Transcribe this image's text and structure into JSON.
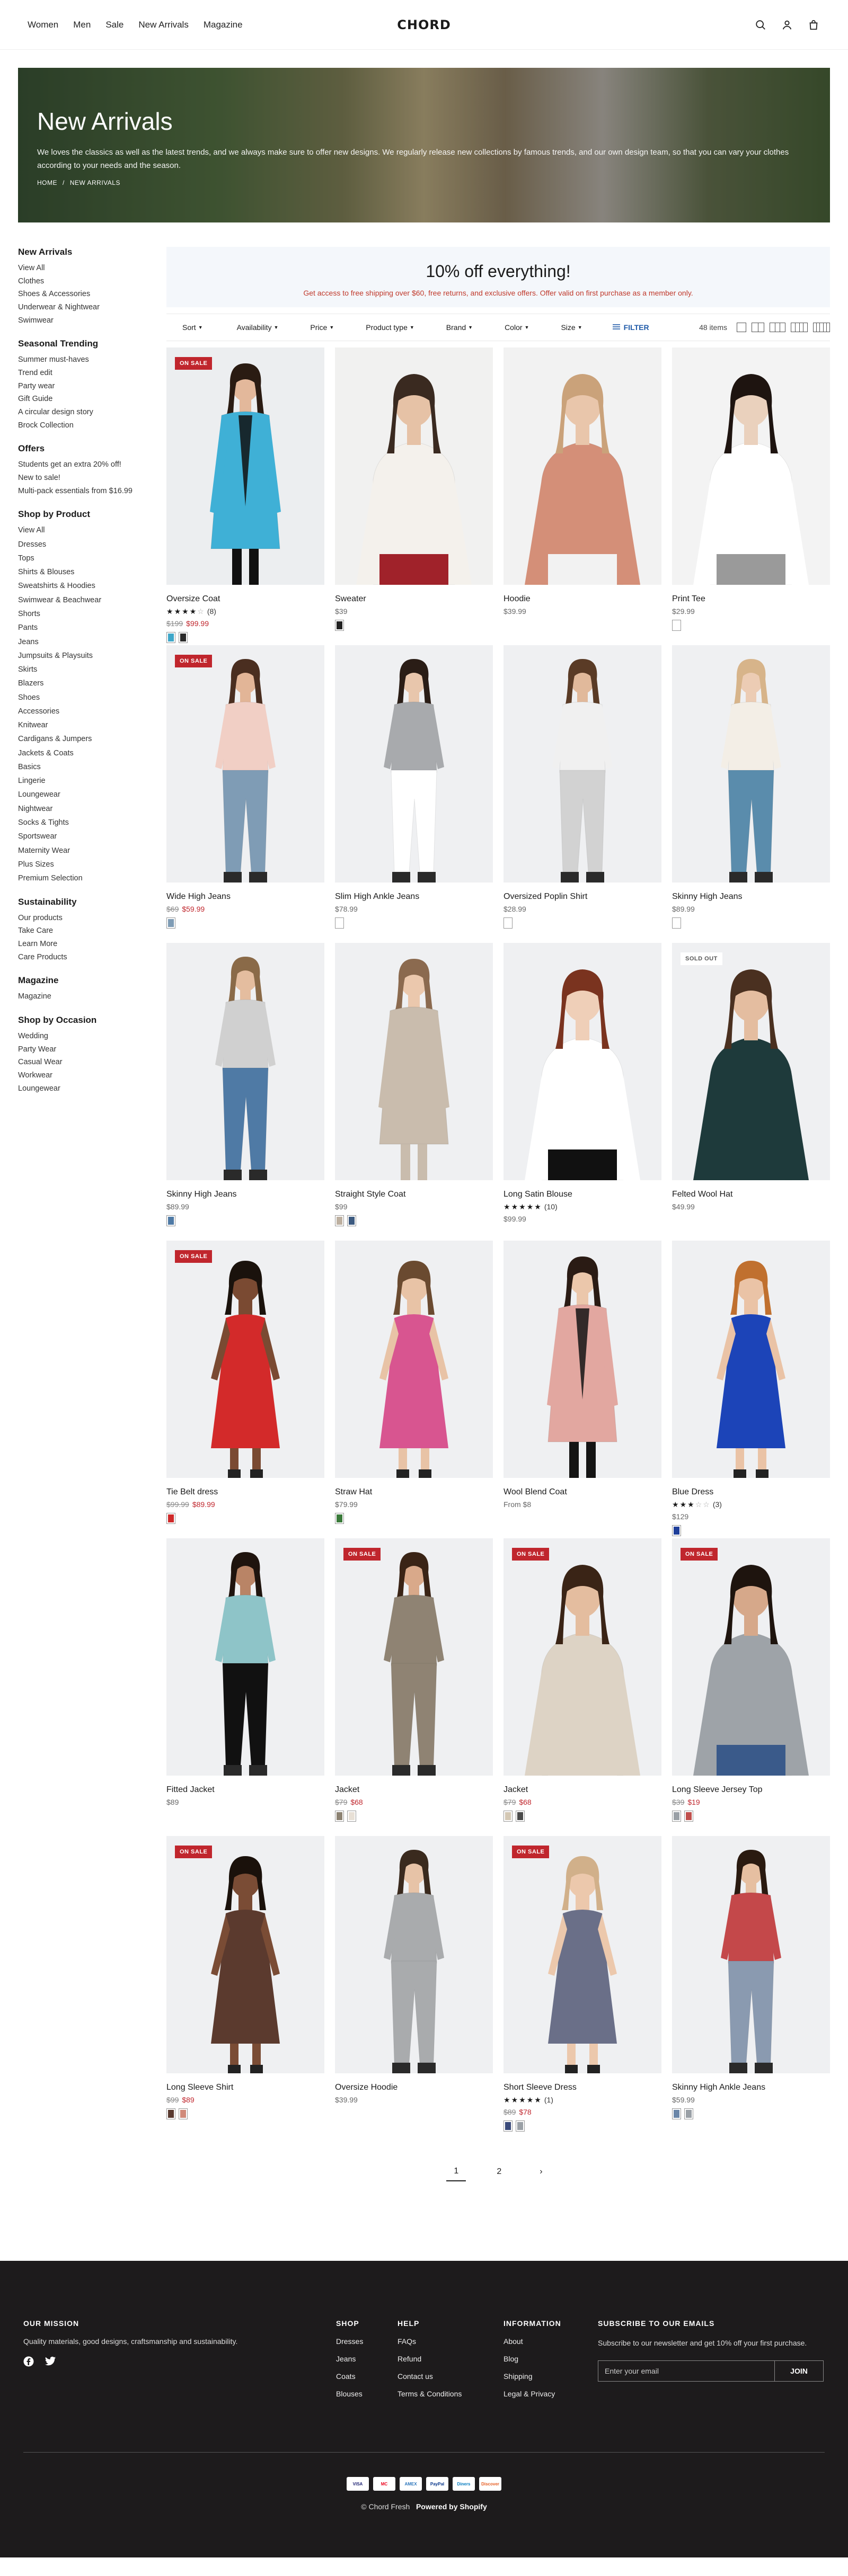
{
  "header": {
    "nav": [
      "Women",
      "Men",
      "Sale",
      "New Arrivals",
      "Magazine"
    ],
    "logo": "CHORD",
    "icons": [
      "search-icon",
      "account-icon",
      "cart-icon"
    ]
  },
  "hero": {
    "title": "New Arrivals",
    "description": "We loves the classics as well as the latest trends, and we always make sure to offer new designs. We regularly release new collections by famous trends, and our own design team, so that you can vary your clothes according to your needs and the season.",
    "breadcrumb": [
      "HOME",
      "/",
      "NEW ARRIVALS"
    ]
  },
  "sidebar": {
    "sections": [
      {
        "heading": "New Arrivals",
        "links": [
          "View All",
          "Clothes",
          "Shoes & Accessories",
          "Underwear & Nightwear",
          "Swimwear"
        ]
      },
      {
        "heading": "Seasonal Trending",
        "links": [
          "Summer must-haves",
          "Trend edit",
          "Party wear",
          "Gift Guide",
          "A circular design story",
          "Brock Collection"
        ]
      },
      {
        "heading": "Offers",
        "links": [
          "Students get an extra 20% off!",
          "New to sale!",
          "Multi-pack essentials from $16.99"
        ]
      },
      {
        "heading": "Shop by Product",
        "links": [
          "View All",
          "Dresses",
          "Tops",
          "Shirts & Blouses",
          "Sweatshirts & Hoodies",
          "Swimwear & Beachwear",
          "Shorts",
          "Pants",
          "Jeans",
          "Jumpsuits & Playsuits",
          "Skirts",
          "Blazers",
          "Shoes",
          "Accessories",
          "Knitwear",
          "Cardigans & Jumpers",
          "Jackets & Coats",
          "Basics",
          "Lingerie",
          "Loungewear",
          "Nightwear",
          "Socks & Tights",
          "Sportswear",
          "Maternity Wear",
          "Plus Sizes",
          "Premium Selection"
        ]
      },
      {
        "heading": "Sustainability",
        "links": [
          "Our products",
          "Take Care",
          "Learn More",
          "Care Products"
        ]
      },
      {
        "heading": "Magazine",
        "links": [
          "Magazine"
        ]
      },
      {
        "heading": "Shop by Occasion",
        "links": [
          "Wedding",
          "Party Wear",
          "Casual Wear",
          "Workwear",
          "Loungewear"
        ]
      }
    ]
  },
  "promo": {
    "title": "10% off everything!",
    "subtitle": "Get access to free shipping over $60, free returns, and exclusive offers. Offer valid on first purchase as a member only."
  },
  "filters": {
    "buttons": [
      "Sort",
      "Availability",
      "Price",
      "Product type",
      "Brand",
      "Color",
      "Size"
    ],
    "filter_label": "FILTER",
    "items_count": "48 items"
  },
  "products": [
    {
      "name": "Oversize Coat",
      "badge": "ON SALE",
      "stars": 4,
      "reviews": "(8)",
      "old_price": "$199",
      "price": "$99.99",
      "colors": [
        "#3fa7c9",
        "#2a2a2a"
      ],
      "img": {
        "bg": "#eceef0",
        "skin": "#e3b89b",
        "hair": "#2a1b12",
        "top": "#3fb0d6",
        "bottom": "#111111",
        "pose": "coat"
      }
    },
    {
      "name": "Sweater",
      "badge": "",
      "stars": 0,
      "reviews": "",
      "old_price": "",
      "price": "$39",
      "colors": [
        "#222222"
      ],
      "img": {
        "bg": "#f1f1f0",
        "skin": "#e6c2a6",
        "hair": "#3a2a20",
        "top": "#f4f1ec",
        "bottom": "#a0222a",
        "pose": "torso"
      }
    },
    {
      "name": "Hoodie",
      "badge": "",
      "stars": 0,
      "reviews": "",
      "old_price": "",
      "price": "$39.99",
      "colors": [],
      "img": {
        "bg": "#f2f2f2",
        "skin": "#e9c6ab",
        "hair": "#caa27a",
        "top": "#d48f78",
        "bottom": "#f2f2f2",
        "pose": "torso"
      }
    },
    {
      "name": "Print Tee",
      "badge": "",
      "stars": 0,
      "reviews": "",
      "old_price": "",
      "price": "$29.99",
      "colors": [
        "#ffffff"
      ],
      "img": {
        "bg": "#f3f3f3",
        "skin": "#ead1bd",
        "hair": "#1e1410",
        "top": "#ffffff",
        "bottom": "#9a9a9a",
        "pose": "torso"
      }
    },
    {
      "name": "Wide High Jeans",
      "badge": "ON SALE",
      "stars": 0,
      "reviews": "",
      "old_price": "$69",
      "price": "$59.99",
      "colors": [
        "#7f9cb5"
      ],
      "img": {
        "bg": "#eff0f2",
        "skin": "#e2b597",
        "hair": "#4a2e20",
        "top": "#f1cfc5",
        "bottom": "#7f9cb5",
        "pose": "full"
      }
    },
    {
      "name": "Slim High Ankle Jeans",
      "badge": "",
      "stars": 0,
      "reviews": "",
      "old_price": "",
      "price": "$78.99",
      "colors": [
        "#ffffff"
      ],
      "img": {
        "bg": "#eff0f2",
        "skin": "#e8c6ac",
        "hair": "#2a1d16",
        "top": "#a8aaad",
        "bottom": "#ffffff",
        "pose": "full"
      }
    },
    {
      "name": "Oversized Poplin Shirt",
      "badge": "",
      "stars": 0,
      "reviews": "",
      "old_price": "",
      "price": "$28.99",
      "colors": [
        "#ffffff"
      ],
      "img": {
        "bg": "#eff0f2",
        "skin": "#e1b99b",
        "hair": "#5a3b26",
        "top": "#f0f0f0",
        "bottom": "#d2d2d2",
        "pose": "full"
      }
    },
    {
      "name": "Skinny High Jeans",
      "badge": "",
      "stars": 0,
      "reviews": "",
      "old_price": "",
      "price": "$89.99",
      "colors": [
        "#ffffff"
      ],
      "img": {
        "bg": "#eff0f2",
        "skin": "#ecccb4",
        "hair": "#d7b48a",
        "top": "#f3eee6",
        "bottom": "#5a8cac",
        "pose": "full"
      }
    },
    {
      "name": "Skinny High Jeans",
      "badge": "",
      "stars": 0,
      "reviews": "",
      "old_price": "",
      "price": "$89.99",
      "colors": [
        "#4f7aa5"
      ],
      "img": {
        "bg": "#eff0f2",
        "skin": "#e4bd9f",
        "hair": "#8a6a48",
        "top": "#d0d0d0",
        "bottom": "#4f7aa5",
        "pose": "full"
      }
    },
    {
      "name": "Straight Style Coat",
      "badge": "",
      "stars": 0,
      "reviews": "",
      "old_price": "",
      "price": "$99",
      "colors": [
        "#bdb0a0",
        "#3c5a80"
      ],
      "img": {
        "bg": "#eff0f2",
        "skin": "#ebc8ad",
        "hair": "#8b6a4f",
        "top": "#c9bcad",
        "bottom": "#c9bcad",
        "pose": "coat"
      }
    },
    {
      "name": "Long Satin Blouse",
      "badge": "",
      "stars": 5,
      "reviews": "(10)",
      "old_price": "",
      "price": "$99.99",
      "colors": [],
      "img": {
        "bg": "#eff0f2",
        "skin": "#efcfb8",
        "hair": "#7a331f",
        "top": "#ffffff",
        "bottom": "#111111",
        "pose": "torso"
      }
    },
    {
      "name": "Felted Wool Hat",
      "badge": "SOLD OUT",
      "stars": 0,
      "reviews": "",
      "old_price": "",
      "price": "$49.99",
      "colors": [],
      "img": {
        "bg": "#eff0f2",
        "skin": "#e4bda0",
        "hair": "#4a3020",
        "top": "#1e3a3b",
        "bottom": "#1e3a3b",
        "pose": "torso"
      }
    },
    {
      "name": "Tie Belt dress",
      "badge": "ON SALE",
      "stars": 0,
      "reviews": "",
      "old_price": "$99.99",
      "price": "$89.99",
      "colors": [
        "#cf2a2a"
      ],
      "img": {
        "bg": "#eff0f2",
        "skin": "#7a4a32",
        "hair": "#1a120c",
        "top": "#d32a2a",
        "bottom": "#d32a2a",
        "pose": "dress"
      }
    },
    {
      "name": "Straw Hat",
      "badge": "",
      "stars": 0,
      "reviews": "",
      "old_price": "",
      "price": "$79.99",
      "colors": [
        "#3a7a3a"
      ],
      "img": {
        "bg": "#eff0f2",
        "skin": "#e8c3a6",
        "hair": "#6a4a30",
        "top": "#d85590",
        "bottom": "#e03d78",
        "pose": "dress"
      }
    },
    {
      "name": "Wool Blend Coat",
      "badge": "",
      "stars": 0,
      "reviews": "",
      "old_price": "",
      "price": "From $8",
      "colors": [],
      "img": {
        "bg": "#eff0f2",
        "skin": "#ebc7ab",
        "hair": "#2a1b14",
        "top": "#e2a7a0",
        "bottom": "#141414",
        "pose": "coat"
      }
    },
    {
      "name": "Blue Dress",
      "badge": "",
      "stars": 3,
      "reviews": "(3)",
      "old_price": "",
      "price": "$129",
      "colors": [
        "#1f3f9a"
      ],
      "img": {
        "bg": "#eff0f2",
        "skin": "#eac3a6",
        "hair": "#c0702f",
        "top": "#1c44b8",
        "bottom": "#1c44b8",
        "pose": "dress"
      }
    },
    {
      "name": "Fitted Jacket",
      "badge": "",
      "stars": 0,
      "reviews": "",
      "old_price": "",
      "price": "$89",
      "colors": [],
      "img": {
        "bg": "#eff0f2",
        "skin": "#b98466",
        "hair": "#1f140e",
        "top": "#8ec4c8",
        "bottom": "#111111",
        "pose": "full"
      }
    },
    {
      "name": "Jacket",
      "badge": "ON SALE",
      "stars": 0,
      "reviews": "",
      "old_price": "$79",
      "price": "$68",
      "colors": [
        "#8c8272",
        "#e8e0d6"
      ],
      "img": {
        "bg": "#eff0f2",
        "skin": "#d9a98a",
        "hair": "#3a2416",
        "top": "#8f8373",
        "bottom": "#8f8373",
        "pose": "full"
      }
    },
    {
      "name": "Jacket",
      "badge": "ON SALE",
      "stars": 0,
      "reviews": "",
      "old_price": "$79",
      "price": "$68",
      "colors": [
        "#d4c8b4",
        "#4a4a4a"
      ],
      "img": {
        "bg": "#eff0f2",
        "skin": "#e4bd9f",
        "hair": "#3a2416",
        "top": "#ddd3c5",
        "bottom": "#ddd3c5",
        "pose": "torso"
      }
    },
    {
      "name": "Long Sleeve Jersey Top",
      "badge": "ON SALE",
      "stars": 0,
      "reviews": "",
      "old_price": "$39",
      "price": "$19",
      "colors": [
        "#9aa0a6",
        "#c0504d"
      ],
      "img": {
        "bg": "#eff0f2",
        "skin": "#d6a88a",
        "hair": "#1e140e",
        "top": "#9ea3a8",
        "bottom": "#3a5a8a",
        "pose": "torso"
      }
    },
    {
      "name": "Long Sleeve Shirt",
      "badge": "ON SALE",
      "stars": 0,
      "reviews": "",
      "old_price": "$99",
      "price": "$89",
      "colors": [
        "#5a3a30",
        "#d08a7a"
      ],
      "img": {
        "bg": "#eff0f2",
        "skin": "#7a4c35",
        "hair": "#1a110b",
        "top": "#5b3a2e",
        "bottom": "#5b3a2e",
        "pose": "dress"
      }
    },
    {
      "name": "Oversize Hoodie",
      "badge": "",
      "stars": 0,
      "reviews": "",
      "old_price": "",
      "price": "$39.99",
      "colors": [],
      "img": {
        "bg": "#eff0f2",
        "skin": "#e7c3a7",
        "hair": "#3a2a1e",
        "top": "#a9abad",
        "bottom": "#a9abad",
        "pose": "full"
      }
    },
    {
      "name": "Short Sleeve Dress",
      "badge": "ON SALE",
      "stars": 5,
      "reviews": "(1)",
      "old_price": "$89",
      "price": "$78",
      "colors": [
        "#3a4a7a",
        "#9aa0a6"
      ],
      "img": {
        "bg": "#eff0f2",
        "skin": "#ecc8ac",
        "hair": "#d1b08a",
        "top": "#6a6f88",
        "bottom": "#6a6f88",
        "pose": "dress"
      }
    },
    {
      "name": "Skinny High Ankle Jeans",
      "badge": "",
      "stars": 0,
      "reviews": "",
      "old_price": "",
      "price": "$59.99",
      "colors": [
        "#6a86a8",
        "#9aa0a6"
      ],
      "img": {
        "bg": "#eff0f2",
        "skin": "#e6bfa1",
        "hair": "#2a1a10",
        "top": "#c4484a",
        "bottom": "#8a9ab0",
        "pose": "full"
      }
    }
  ],
  "pagination": {
    "pages": [
      "1",
      "2"
    ],
    "next": "›"
  },
  "footer": {
    "mission_heading": "OUR MISSION",
    "mission_text": "Quality materials, good designs, craftsmanship and sustainability.",
    "columns": [
      {
        "heading": "SHOP",
        "links": [
          "Dresses",
          "Jeans",
          "Coats",
          "Blouses"
        ]
      },
      {
        "heading": "HELP",
        "links": [
          "FAQs",
          "Refund",
          "Contact us",
          "Terms & Conditions"
        ]
      },
      {
        "heading": "INFORMATION",
        "links": [
          "About",
          "Blog",
          "Shipping",
          "Legal & Privacy"
        ]
      }
    ],
    "subscribe_heading": "SUBSCRIBE TO OUR EMAILS",
    "subscribe_text": "Subscribe to our newsletter and get 10% off your first purchase.",
    "email_placeholder": "Enter your email",
    "join_label": "JOIN",
    "payments": [
      "VISA",
      "MC",
      "AMEX",
      "PayPal",
      "Diners",
      "Discover"
    ],
    "copyright_prefix": "© Chord Fresh",
    "copyright_powered": "Powered by Shopify"
  }
}
